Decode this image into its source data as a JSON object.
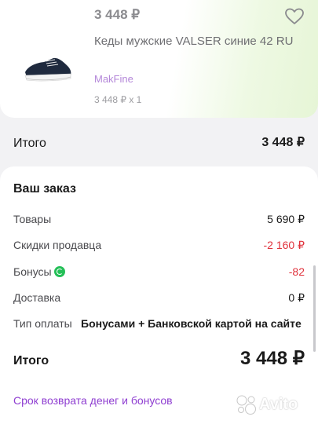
{
  "product": {
    "price": "3 448 ₽",
    "title": "Кеды мужские VALSER синие 42 RU",
    "seller": "MakFine",
    "quantity_line": "3 448 ₽ x 1",
    "image_icon": "sneaker-image",
    "favorite_icon": "heart-outline-icon"
  },
  "summary_bar": {
    "label": "Итого",
    "value": "3 448 ₽"
  },
  "order": {
    "title": "Ваш заказ",
    "rows": [
      {
        "label": "Товары",
        "value": "5 690 ₽"
      },
      {
        "label": "Скидки продавца",
        "value": "-2 160 ₽"
      },
      {
        "label": "Бонусы",
        "value": "-82"
      },
      {
        "label": "Доставка",
        "value": "0 ₽"
      }
    ],
    "payment": {
      "label": "Тип оплаты",
      "value": "Бонусами + Банковской картой на сайте"
    },
    "grand_total_label": "Итого",
    "grand_total_value": "3 448 ₽",
    "refund_link": "Срок возврата денег и бонусов"
  },
  "watermark": {
    "text": "Avito",
    "logo_icon": "avito-logo-icon"
  },
  "colors": {
    "discount_red": "#e0323c",
    "link_purple": "#8f3ed1",
    "bonus_green": "#24bf57"
  }
}
